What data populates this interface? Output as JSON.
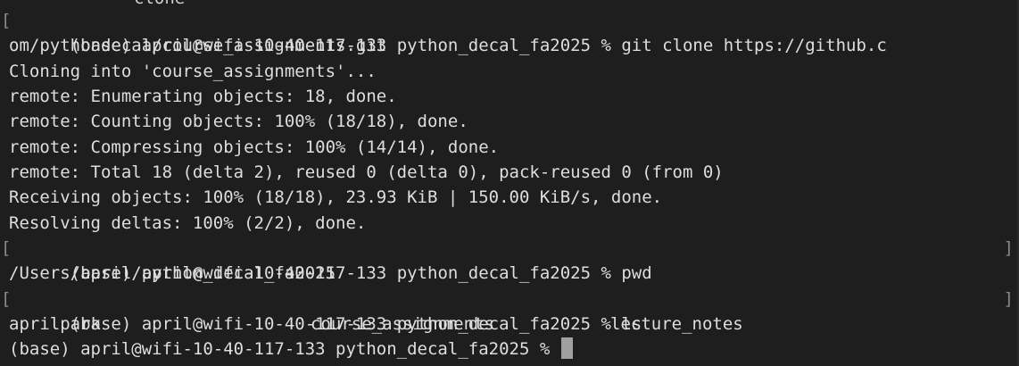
{
  "terminal": {
    "cut_top_text": "clone",
    "lines": [
      "(base) april@wifi-10-40-117-133 python_decal_fa2025 % git clone https://github.c",
      "om/pythondecal/course_assignments.git",
      "Cloning into 'course_assignments'...",
      "remote: Enumerating objects: 18, done.",
      "remote: Counting objects: 100% (18/18), done.",
      "remote: Compressing objects: 100% (14/14), done.",
      "remote: Total 18 (delta 2), reused 0 (delta 0), pack-reused 0 (from 0)",
      "Receiving objects: 100% (18/18), 23.93 KiB | 150.00 KiB/s, done.",
      "Resolving deltas: 100% (2/2), done.",
      "(base) april@wifi-10-40-117-133 python_decal_fa2025 % pwd",
      "/Users/april/python_decal_fa2025",
      "(base) april@wifi-10-40-117-133 python_decal_fa2025 % ls"
    ],
    "ls_output": [
      "aprilpark",
      "course_assignments",
      "lecture_notes"
    ],
    "current_prompt": "(base) april@wifi-10-40-117-133 python_decal_fa2025 % ",
    "bracket_left": "[",
    "bracket_right": "]"
  },
  "colors": {
    "background": "#1e1e1e",
    "text": "#dedede",
    "cursor": "#a0a0a0",
    "bracket": "#8a8a8a"
  }
}
